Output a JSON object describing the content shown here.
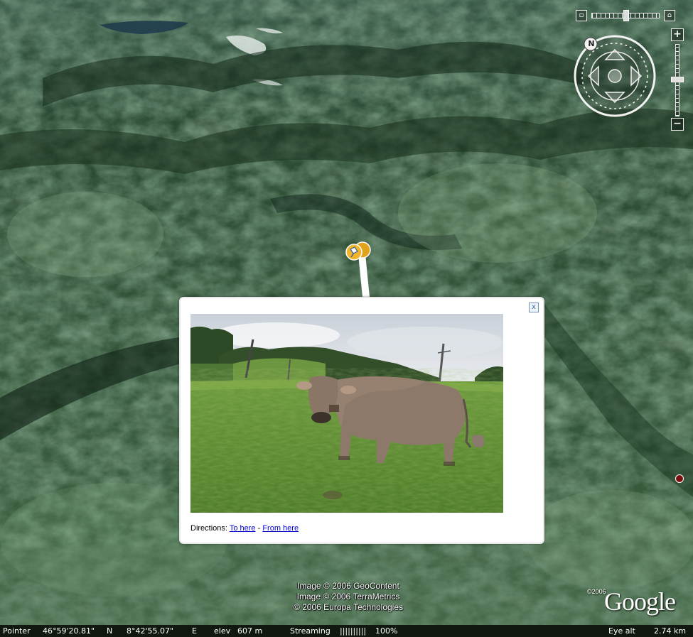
{
  "popup": {
    "close_label": "x",
    "directions_label": "Directions:",
    "to_here": "To here",
    "separator": "-",
    "from_here": "From here"
  },
  "attribution": {
    "line1": "Image © 2006 GeoContent",
    "line2": "Image © 2006 TerraMetrics",
    "line3": "© 2006 Europa Technologies"
  },
  "logo": {
    "copyright": "©2006",
    "word": "Google"
  },
  "status": {
    "pointer_label": "Pointer",
    "latitude": "46°59'20.81\"",
    "lat_hemi": "N",
    "longitude": "8°42'55.07\"",
    "lon_hemi": "E",
    "elev_label": "elev",
    "elevation": "607 m",
    "streaming_label": "Streaming",
    "streaming_bar": "||||||||||",
    "streaming_percent": "100%",
    "eye_alt_label": "Eye alt",
    "eye_alt": "2.74 km"
  },
  "nav": {
    "compass_north": "N",
    "zoom_in": "+",
    "zoom_out": "−"
  },
  "icons": {
    "pin": "pushpin-icon",
    "compass": "compass-icon",
    "close": "close-icon"
  }
}
